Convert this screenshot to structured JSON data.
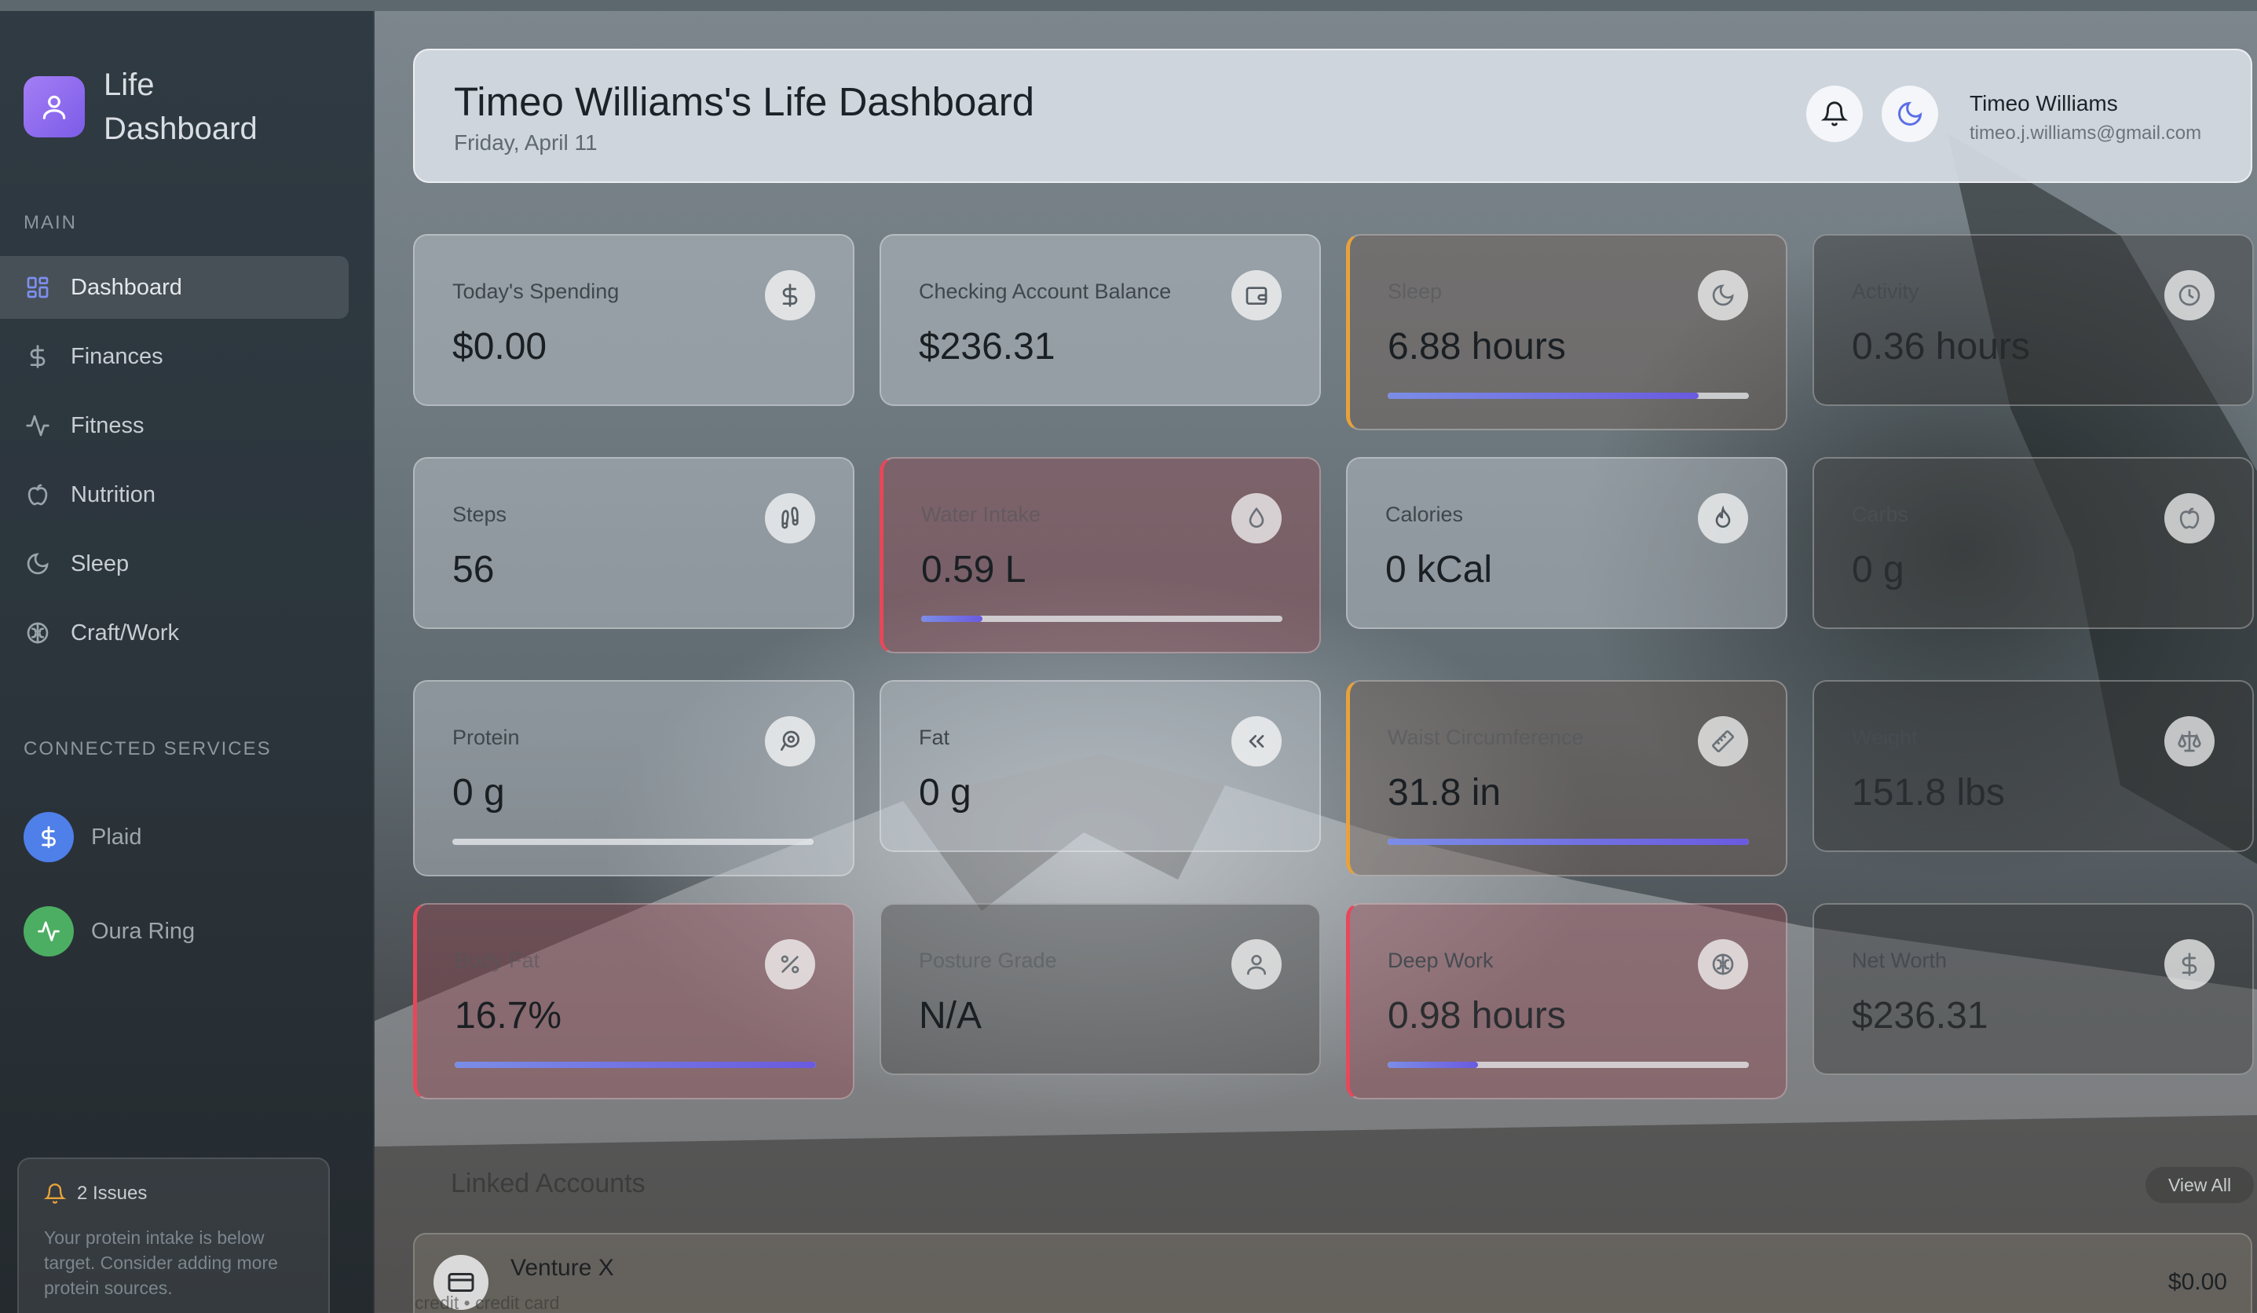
{
  "sidebar": {
    "brand": "Life Dashboard",
    "main_label": "MAIN",
    "nav": [
      {
        "label": "Dashboard",
        "icon": "grid-icon"
      },
      {
        "label": "Finances",
        "icon": "dollar-icon"
      },
      {
        "label": "Fitness",
        "icon": "activity-icon"
      },
      {
        "label": "Nutrition",
        "icon": "apple-icon"
      },
      {
        "label": "Sleep",
        "icon": "moon-icon"
      },
      {
        "label": "Craft/Work",
        "icon": "brain-icon"
      }
    ],
    "services_label": "CONNECTED SERVICES",
    "services": [
      {
        "label": "Plaid",
        "color": "#4f7fe8"
      },
      {
        "label": "Oura Ring",
        "color": "#4cae62"
      }
    ],
    "issues": {
      "title": "2 Issues",
      "text": "Your protein intake is below target. Consider adding more protein sources."
    }
  },
  "header": {
    "title": "Timeo Williams's Life Dashboard",
    "date": "Friday, April 11",
    "user_name": "Timeo Williams",
    "user_email": "timeo.j.williams@gmail.com"
  },
  "cards": [
    {
      "label": "Today's Spending",
      "value": "$0.00",
      "icon": "dollar-icon"
    },
    {
      "label": "Checking Account Balance",
      "value": "$236.31",
      "icon": "wallet-icon"
    },
    {
      "label": "Sleep",
      "value": "6.88 hours",
      "icon": "moon-icon",
      "progress": 0.86
    },
    {
      "label": "Activity",
      "value": "0.36 hours",
      "icon": "clock-icon"
    },
    {
      "label": "Steps",
      "value": "56",
      "icon": "footprints-icon"
    },
    {
      "label": "Water Intake",
      "value": "0.59 L",
      "icon": "droplet-icon",
      "progress": 0.17
    },
    {
      "label": "Calories",
      "value": "0 kCal",
      "icon": "flame-icon"
    },
    {
      "label": "Carbs",
      "value": "0 g",
      "icon": "apple-icon"
    },
    {
      "label": "Protein",
      "value": "0 g",
      "icon": "beef-icon",
      "progress": 0.0
    },
    {
      "label": "Fat",
      "value": "0 g",
      "icon": "chevrons-left-icon"
    },
    {
      "label": "Waist Circumference",
      "value": "31.8 in",
      "icon": "ruler-icon",
      "progress": 1.0
    },
    {
      "label": "Weight",
      "value": "151.8 lbs",
      "icon": "scale-icon"
    },
    {
      "label": "Body Fat",
      "value": "16.7%",
      "icon": "percent-icon",
      "progress": 1.0
    },
    {
      "label": "Posture Grade",
      "value": "N/A",
      "icon": "user-icon"
    },
    {
      "label": "Deep Work",
      "value": "0.98 hours",
      "icon": "brain-icon",
      "progress": 0.25
    },
    {
      "label": "Net Worth",
      "value": "$236.31",
      "icon": "dollar-icon"
    }
  ],
  "accounts": {
    "title": "Linked Accounts",
    "view_all": "View All",
    "items": [
      {
        "name": "Venture X",
        "sub": "credit • credit card",
        "amount": "$0.00"
      }
    ]
  },
  "colors": {
    "accent_purple": "#8b6cf0",
    "progress_blue": "#7b8de6",
    "amber": "#e8a23a",
    "red": "#e8475a"
  }
}
